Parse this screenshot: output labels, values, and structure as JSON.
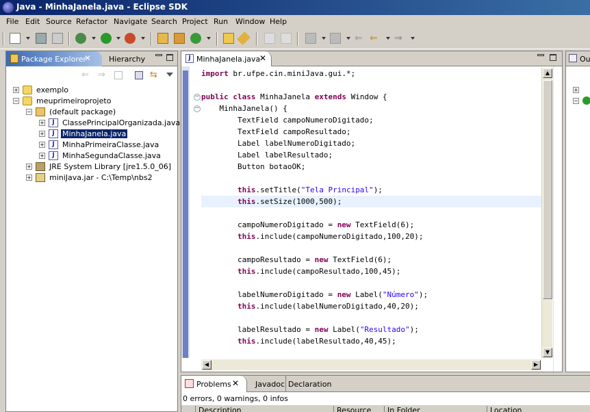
{
  "window": {
    "title": "Java - MinhaJanela.java - Eclipse SDK"
  },
  "menu": [
    "File",
    "Edit",
    "Source",
    "Refactor",
    "Navigate",
    "Search",
    "Project",
    "Run",
    "Window",
    "Help"
  ],
  "package_explorer": {
    "tab_label": "Package Explorer",
    "other_tab": "Hierarchy",
    "tree": [
      {
        "label": "exemplo",
        "icon": "project-icon",
        "expander": "+",
        "depth": 0
      },
      {
        "label": "meuprimeiroprojeto",
        "icon": "project-icon",
        "expander": "−",
        "depth": 0
      },
      {
        "label": "(default package)",
        "icon": "package-icon",
        "expander": "−",
        "depth": 1
      },
      {
        "label": "ClassePrincipalOrganizada.java",
        "icon": "java-file-icon",
        "expander": "+",
        "depth": 2
      },
      {
        "label": "MinhaJanela.java",
        "icon": "java-file-icon",
        "expander": "+",
        "depth": 2,
        "selected": true
      },
      {
        "label": "MinhaPrimeiraClasse.java",
        "icon": "java-file-icon",
        "expander": "+",
        "depth": 2
      },
      {
        "label": "MinhaSegundaClasse.java",
        "icon": "java-file-icon",
        "expander": "+",
        "depth": 2
      },
      {
        "label": "JRE System Library [jre1.5.0_06]",
        "icon": "library-icon",
        "expander": "+",
        "depth": 1
      },
      {
        "label": "miniJava.jar - C:\\Temp\\nbs2",
        "icon": "jar-icon",
        "expander": "+",
        "depth": 1
      }
    ]
  },
  "editor": {
    "tab_label": "MinhaJanela.java",
    "lines": [
      [
        [
          "kw",
          "import"
        ],
        [
          "t",
          " br.ufpe.cin.miniJava.gui.*;"
        ]
      ],
      [],
      [
        [
          "kw",
          "public"
        ],
        [
          "t",
          " "
        ],
        [
          "kw",
          "class"
        ],
        [
          "t",
          " MinhaJanela "
        ],
        [
          "kw",
          "extends"
        ],
        [
          "t",
          " Window {"
        ]
      ],
      [
        [
          "t",
          "    MinhaJanela() {"
        ]
      ],
      [
        [
          "t",
          "        TextField campoNumeroDigitado;"
        ]
      ],
      [
        [
          "t",
          "        TextField campoResultado;"
        ]
      ],
      [
        [
          "t",
          "        Label labelNumeroDigitado;"
        ]
      ],
      [
        [
          "t",
          "        Label labelResultado;"
        ]
      ],
      [
        [
          "t",
          "        Button botaoOK;"
        ]
      ],
      [],
      [
        [
          "t",
          "        "
        ],
        [
          "kw",
          "this"
        ],
        [
          "t",
          ".setTitle("
        ],
        [
          "str",
          "\"Tela Principal\""
        ],
        [
          "t",
          ");"
        ]
      ],
      [
        [
          "t",
          "        "
        ],
        [
          "kw",
          "this"
        ],
        [
          "t",
          ".setSize(1000,500);"
        ]
      ],
      [],
      [
        [
          "t",
          "        campoNumeroDigitado = "
        ],
        [
          "kw",
          "new"
        ],
        [
          "t",
          " TextField(6);"
        ]
      ],
      [
        [
          "t",
          "        "
        ],
        [
          "kw",
          "this"
        ],
        [
          "t",
          ".include(campoNumeroDigitado,100,20);"
        ]
      ],
      [],
      [
        [
          "t",
          "        campoResultado = "
        ],
        [
          "kw",
          "new"
        ],
        [
          "t",
          " TextField(6);"
        ]
      ],
      [
        [
          "t",
          "        "
        ],
        [
          "kw",
          "this"
        ],
        [
          "t",
          ".include(campoResultado,100,45);"
        ]
      ],
      [],
      [
        [
          "t",
          "        labelNumeroDigitado = "
        ],
        [
          "kw",
          "new"
        ],
        [
          "t",
          " Label("
        ],
        [
          "str",
          "\"Número\""
        ],
        [
          "t",
          ");"
        ]
      ],
      [
        [
          "t",
          "        "
        ],
        [
          "kw",
          "this"
        ],
        [
          "t",
          ".include(labelNumeroDigitado,40,20);"
        ]
      ],
      [],
      [
        [
          "t",
          "        labelResultado = "
        ],
        [
          "kw",
          "new"
        ],
        [
          "t",
          " Label("
        ],
        [
          "str",
          "\"Resultado\""
        ],
        [
          "t",
          ");"
        ]
      ],
      [
        [
          "t",
          "        "
        ],
        [
          "kw",
          "this"
        ],
        [
          "t",
          ".include(labelResultado,40,45);"
        ]
      ]
    ],
    "highlighted_line": 11
  },
  "outline": {
    "tab_label": "Ou"
  },
  "problems": {
    "tab_label": "Problems",
    "other_tabs": [
      "Javadoc",
      "Declaration"
    ],
    "summary": "0 errors, 0 warnings, 0 infos",
    "columns": [
      "Description",
      "Resource",
      "In Folder",
      "Location"
    ]
  },
  "colors": {
    "keyword": "#7f0055",
    "string": "#2a00ff",
    "selection": "#0a246a",
    "current_line": "#e8f2fe"
  }
}
